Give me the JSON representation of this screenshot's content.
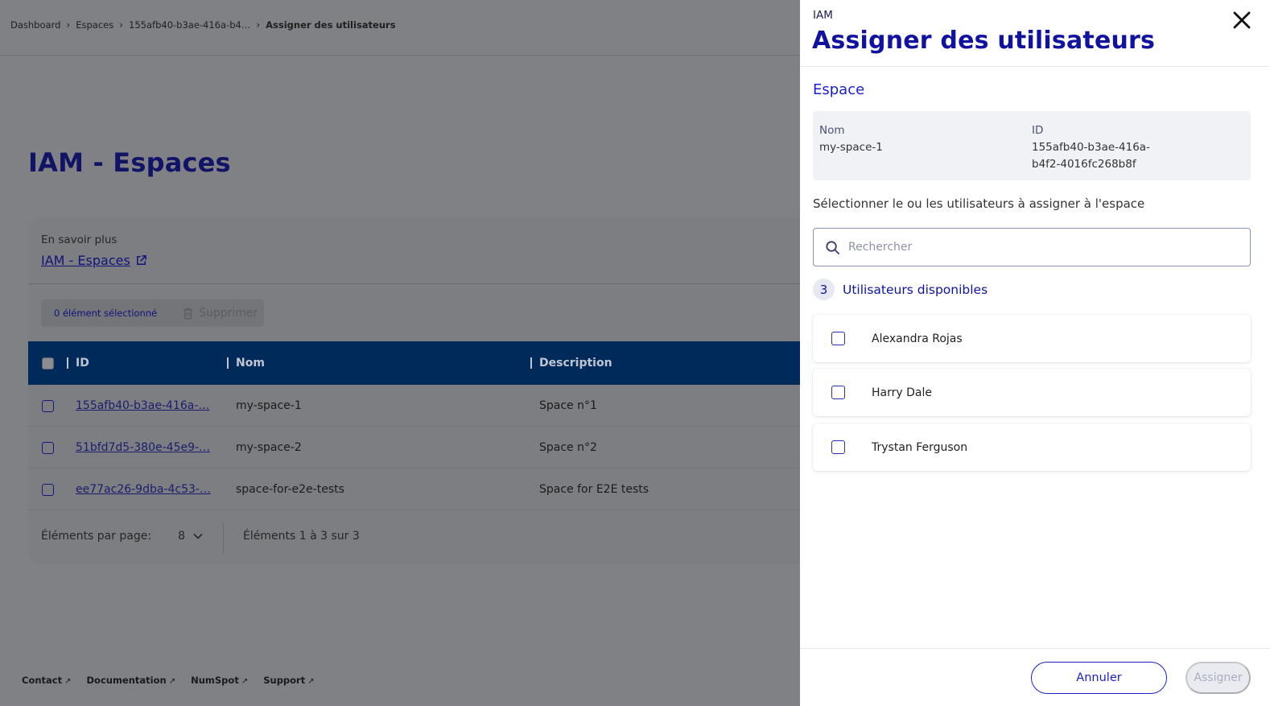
{
  "breadcrumb": {
    "items": [
      "Dashboard",
      "Espaces",
      "155afb40-b3ae-416a-b4…"
    ],
    "current": "Assigner des utilisateurs"
  },
  "page": {
    "title": "IAM - Espaces"
  },
  "learn_more": {
    "label": "En savoir plus",
    "link": "IAM - Espaces"
  },
  "selection": {
    "count_text": "0 élément sélectionné",
    "delete_label": "Supprimer"
  },
  "table": {
    "columns": [
      "ID",
      "Nom",
      "Description"
    ],
    "rows": [
      {
        "id": "155afb40-b3ae-416a-…",
        "name": "my-space-1",
        "description": "Space n°1"
      },
      {
        "id": "51bfd7d5-380e-45e9-…",
        "name": "my-space-2",
        "description": "Space n°2"
      },
      {
        "id": "ee77ac26-9dba-4c53-…",
        "name": "space-for-e2e-tests",
        "description": "Space for E2E tests"
      }
    ]
  },
  "pagination": {
    "per_page_label": "Éléments par page:",
    "per_page_value": "8",
    "range": "Éléments 1 à 3 sur 3"
  },
  "site_footer": {
    "links": [
      "Contact",
      "Documentation",
      "NumSpot",
      "Support"
    ]
  },
  "drawer": {
    "subtitle": "IAM",
    "title": "Assigner des utilisateurs",
    "section_title": "Espace",
    "space": {
      "name_label": "Nom",
      "name_value": "my-space-1",
      "id_label": "ID",
      "id_value_line1": "155afb40-b3ae-416a-",
      "id_value_line2": "b4f2-4016fc268b8f"
    },
    "instruction": "Sélectionner le ou les utilisateurs à assigner à l'espace",
    "search_placeholder": "Rechercher",
    "available_count": "3",
    "available_label": "Utilisateurs disponibles",
    "users": [
      "Alexandra Rojas",
      "Harry Dale",
      "Trystan Ferguson"
    ],
    "cancel_label": "Annuler",
    "assign_label": "Assigner"
  },
  "colors": {
    "overlay": "#808184",
    "brand_blue": "#0f13a0",
    "table_header": "#002a59",
    "drawer_bg": "#ffffff"
  }
}
